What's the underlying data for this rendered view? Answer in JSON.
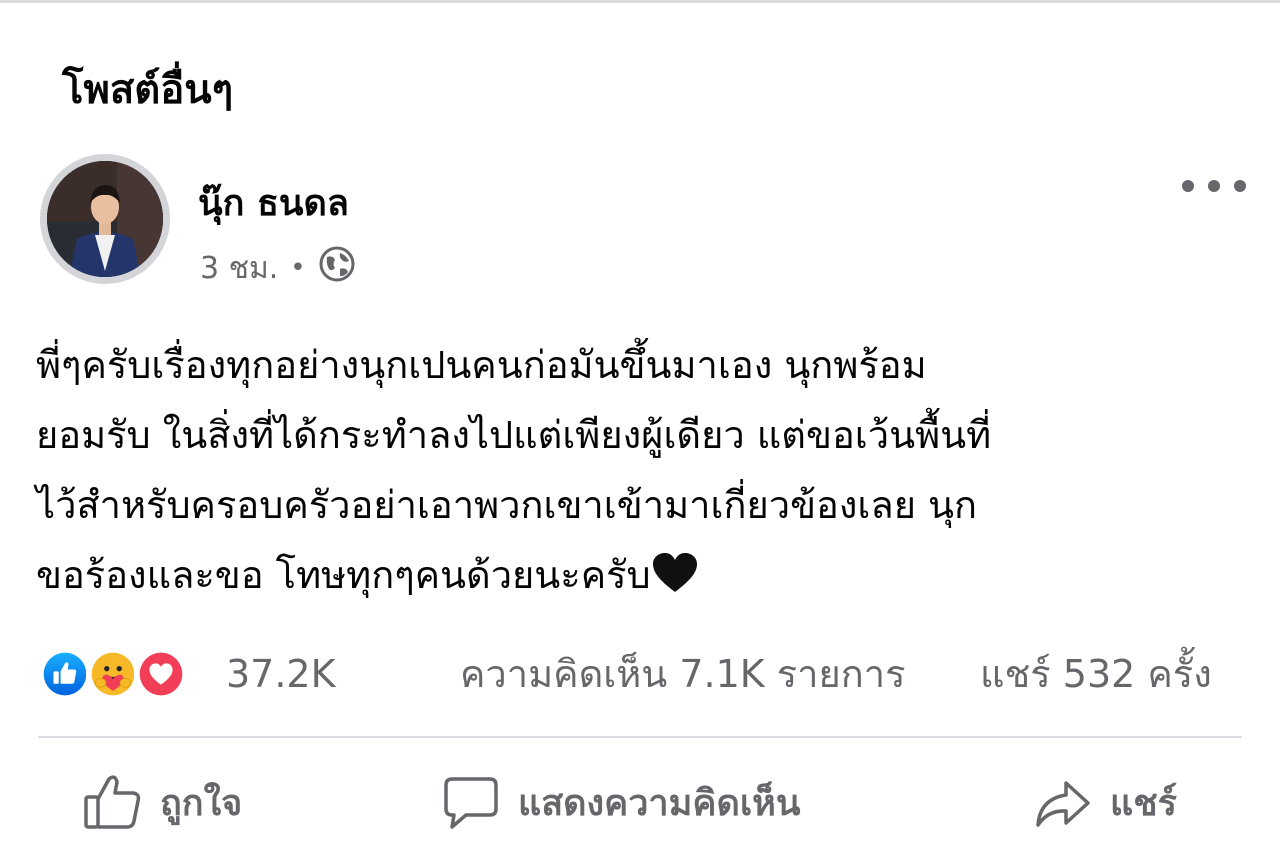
{
  "section": {
    "title": "โพสต์อื่นๆ"
  },
  "post": {
    "author": "นุ๊ก ธนดล",
    "time": "3 ชม.",
    "separator": "•",
    "lines": [
      "พี่ๆครับเรื่องทุกอย่างนุกเปนคนก่อมันขึ้นมาเอง นุกพร้อม",
      "ยอมรับ ในสิ่งที่ได้กระทำลงไปแต่เพียงผู้เดียว แต่ขอเว้นพื้นที่",
      "ไว้สำหรับครอบครัวอย่าเอาพวกเขาเข้ามาเกี่ยวข้องเลย นุก",
      "ขอร้องและขอ โทษทุกๆคนด้วยนะครับ"
    ],
    "trailing_emoji": "black-heart",
    "privacy_icon": "globe-icon"
  },
  "stats": {
    "reactions": "37.2K",
    "comments": "ความคิดเห็น 7.1K รายการ",
    "shares": "แชร์ 532 ครั้ง",
    "reaction_icons": [
      "like-icon",
      "care-icon",
      "love-icon"
    ]
  },
  "actions": {
    "like": "ถูกใจ",
    "comment": "แสดงความคิดเห็น",
    "share": "แชร์"
  },
  "colors": {
    "like_blue": "#1877f2",
    "love_red": "#f33e58",
    "care_yellow": "#f7b928",
    "secondary_text": "#65676b"
  }
}
